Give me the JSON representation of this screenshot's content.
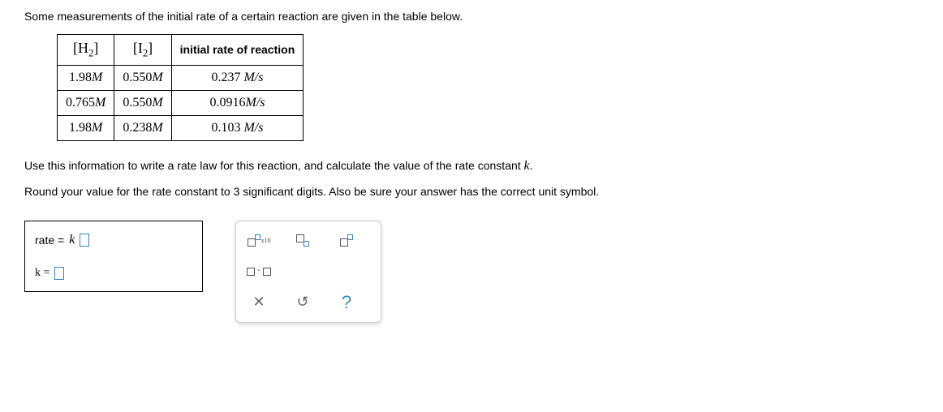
{
  "intro": "Some measurements of the initial rate of a certain reaction are given in the table below.",
  "table": {
    "h2_label": "H",
    "h2_sub": "2",
    "i2_label": "I",
    "i2_sub": "2",
    "rate_header": "initial rate of reaction",
    "rows": [
      {
        "h2": "1.98",
        "i2": "0.550",
        "rate": "0.237",
        "unit1": "M",
        "unit2": "M",
        "runit": "M/s"
      },
      {
        "h2": "0.765",
        "i2": "0.550",
        "rate": "0.0916",
        "unit1": "M",
        "unit2": "M",
        "runit": "M/s"
      },
      {
        "h2": "1.98",
        "i2": "0.238",
        "rate": "0.103",
        "unit1": "M",
        "unit2": "M",
        "runit": "M/s"
      }
    ]
  },
  "instr1": "Use this information to write a rate law for this reaction, and calculate the value of the rate constant ",
  "instr1_k": "k",
  "instr1_end": ".",
  "instr2": "Round your value for the rate constant to 3 significant digits. Also be sure your answer has the correct unit symbol.",
  "answer": {
    "rate_prefix": "rate =",
    "rate_k": "k",
    "k_prefix": "k ="
  },
  "palette": {
    "x10": "x10",
    "clear": "✕",
    "reset": "↺",
    "help": "?"
  },
  "chart_data": {
    "type": "table",
    "title": "Initial reaction rate measurements",
    "columns": [
      "[H2] (M)",
      "[I2] (M)",
      "initial rate (M/s)"
    ],
    "rows": [
      [
        1.98,
        0.55,
        0.237
      ],
      [
        0.765,
        0.55,
        0.0916
      ],
      [
        1.98,
        0.238,
        0.103
      ]
    ]
  }
}
